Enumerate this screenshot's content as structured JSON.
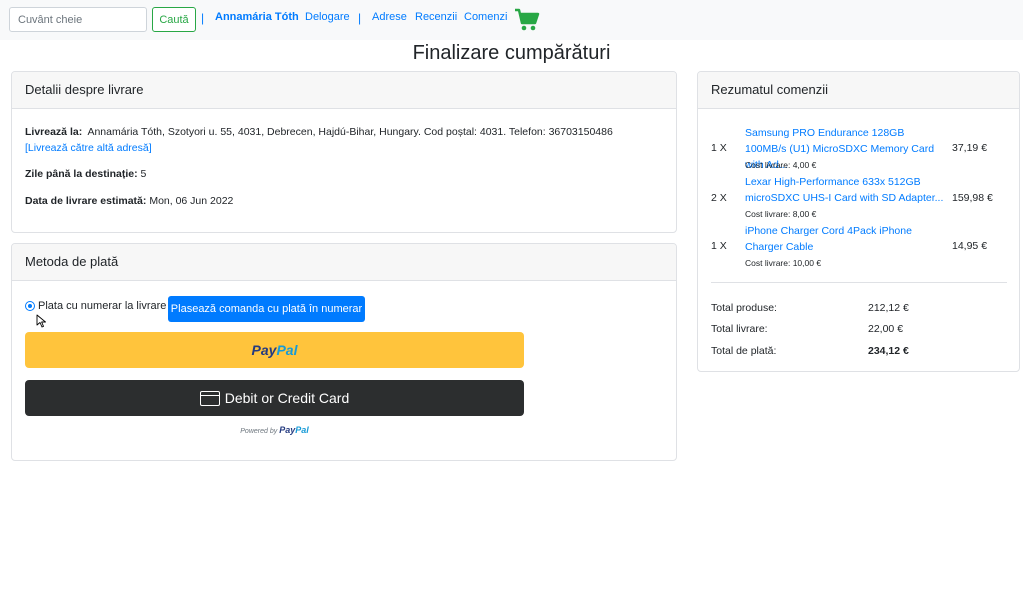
{
  "navbar": {
    "search_placeholder": "Cuvânt cheie",
    "search_button": "Caută",
    "separator": "|",
    "user_name": "Annamária Tóth",
    "links": {
      "logout": "Delogare",
      "addresses": "Adrese",
      "reviews": "Recenzii",
      "orders": "Comenzi"
    },
    "cart_icon": "shopping-cart-icon",
    "cart_color": "#28a745"
  },
  "page": {
    "title": "Finalizare cumpărături"
  },
  "delivery": {
    "header": "Detalii despre livrare",
    "ship_to_label": "Livrează la:",
    "ship_to_value": "Annamária Tóth, Szotyori u. 55, 4031, Debrecen, Hajdú-Bihar, Hungary. Cod poștal: 4031. Telefon: 36703150486",
    "change_address_link": "[Livrează către altă adresă]",
    "days_label": "Zile până la destinație:",
    "days_value": "5",
    "estimated_label": "Data de livrare estimată:",
    "estimated_value": "Mon, 06 Jun 2022"
  },
  "payment": {
    "header": "Metoda de plată",
    "cash_option": "Plata cu numerar la livrare",
    "cash_button": "Plasează comanda cu plată în numerar",
    "paypal_part1": "Pay",
    "paypal_part2": "Pal",
    "card_button": "Debit or Credit Card",
    "powered_by": "Powered by",
    "paypal_color": "#ffc43c"
  },
  "summary": {
    "header": "Rezumatul comenzii",
    "items": [
      {
        "qty": "1 X",
        "name": "Samsung PRO Endurance 128GB 100MB/s (U1) MicroSDXC Memory Card with Ad...",
        "shipping": "Cost livrare: 4,00 €",
        "price": "37,19 €"
      },
      {
        "qty": "2 X",
        "name": "Lexar High-Performance 633x 512GB microSDXC UHS-I Card with SD Adapter...",
        "shipping": "Cost livrare: 8,00 €",
        "price": "159,98 €"
      },
      {
        "qty": "1 X",
        "name": "iPhone Charger Cord 4Pack iPhone Charger Cable",
        "shipping": "Cost livrare: 10,00 €",
        "price": "14,95 €"
      }
    ],
    "totals": {
      "products_label": "Total produse:",
      "products_value": "212,12 €",
      "shipping_label": "Total livrare:",
      "shipping_value": "22,00 €",
      "grand_label": "Total de plată:",
      "grand_value": "234,12 €"
    }
  }
}
